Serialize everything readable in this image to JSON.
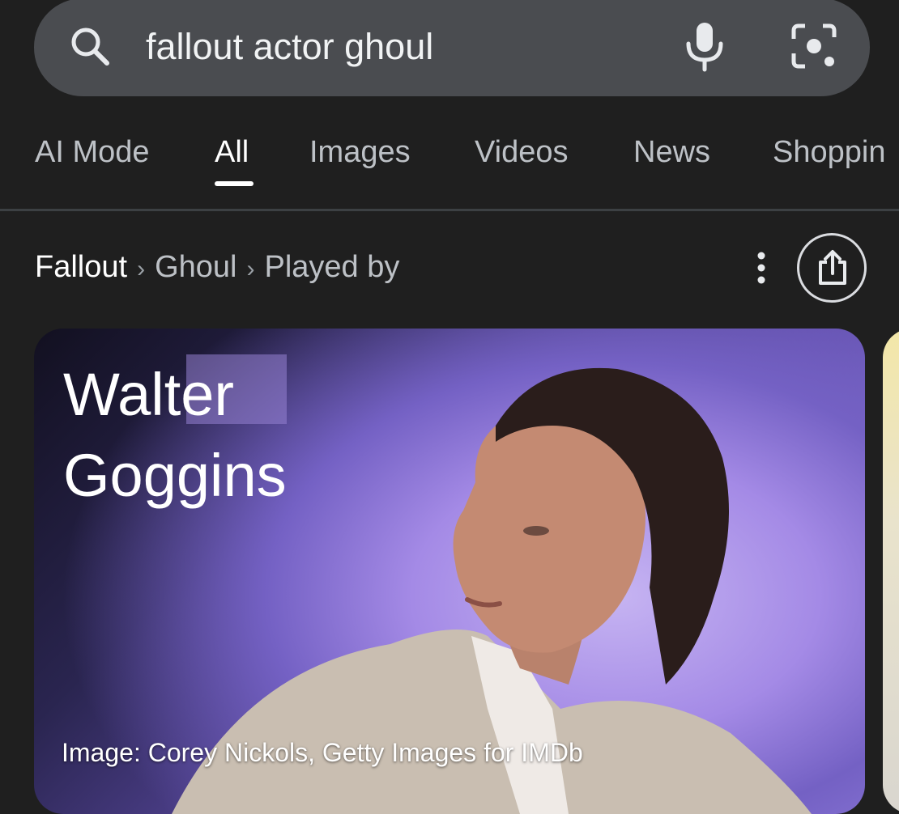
{
  "search": {
    "query": "fallout actor ghoul",
    "icons": [
      "search-icon",
      "mic-icon",
      "lens-icon"
    ]
  },
  "tabs": [
    {
      "label": "AI Mode",
      "active": false
    },
    {
      "label": "All",
      "active": true
    },
    {
      "label": "Images",
      "active": false
    },
    {
      "label": "Videos",
      "active": false
    },
    {
      "label": "News",
      "active": false
    },
    {
      "label": "Shoppin",
      "active": false
    }
  ],
  "breadcrumb": {
    "items": [
      "Fallout",
      "Ghoul",
      "Played by"
    ],
    "separator": "›"
  },
  "card": {
    "name_line1": "Walter",
    "name_line2": "Goggins",
    "caption": "Image: Corey Nickols, Getty Images for IMDb"
  },
  "colors": {
    "background": "#1f1f1f",
    "search_bar": "#4a4c50",
    "tab_active": "#ffffff",
    "tab_inactive": "#bdc1c6"
  }
}
